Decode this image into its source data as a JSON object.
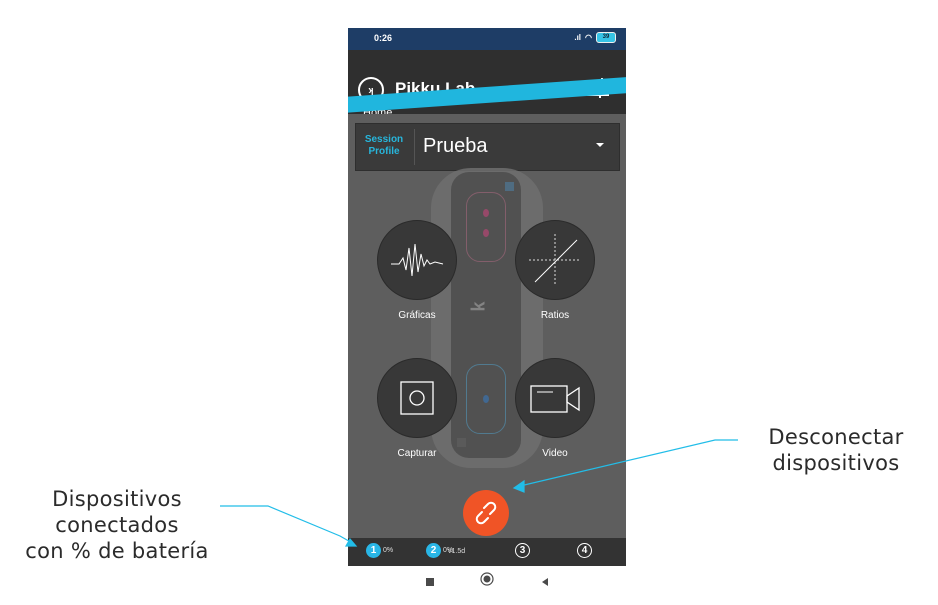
{
  "annotations": {
    "left_lines": [
      "Dispositivos",
      "conectados",
      "con % de batería"
    ],
    "right_lines": [
      "Desconectar",
      "dispositivos"
    ]
  },
  "status_bar": {
    "time": "0:26",
    "signal": ".ıl",
    "wifi": "◠",
    "battery": "39"
  },
  "header": {
    "logo_text": "ʞ",
    "app_title": "Pikku Lab",
    "breadcrumb": "Home"
  },
  "session_profile": {
    "label_line1": "Session",
    "label_line2": "Profile",
    "value": "Prueba"
  },
  "functions": [
    {
      "label": "Gráficas",
      "icon": "waveform-icon"
    },
    {
      "label": "Ratios",
      "icon": "crosshair-chart-icon"
    },
    {
      "label": "Capturar",
      "icon": "capture-square-icon"
    },
    {
      "label": "Video",
      "icon": "video-camera-icon"
    }
  ],
  "devices": [
    {
      "number": "1",
      "battery": "0%",
      "connected": true
    },
    {
      "number": "2",
      "battery": "0%",
      "connected": true
    },
    {
      "number": "3",
      "connected": false
    },
    {
      "number": "4",
      "connected": false
    }
  ],
  "version": "v1.5d",
  "colors": {
    "accent": "#20b6de",
    "disconnect": "#f05426",
    "header": "#2f2f2f",
    "statusbar": "#1e3d66"
  }
}
